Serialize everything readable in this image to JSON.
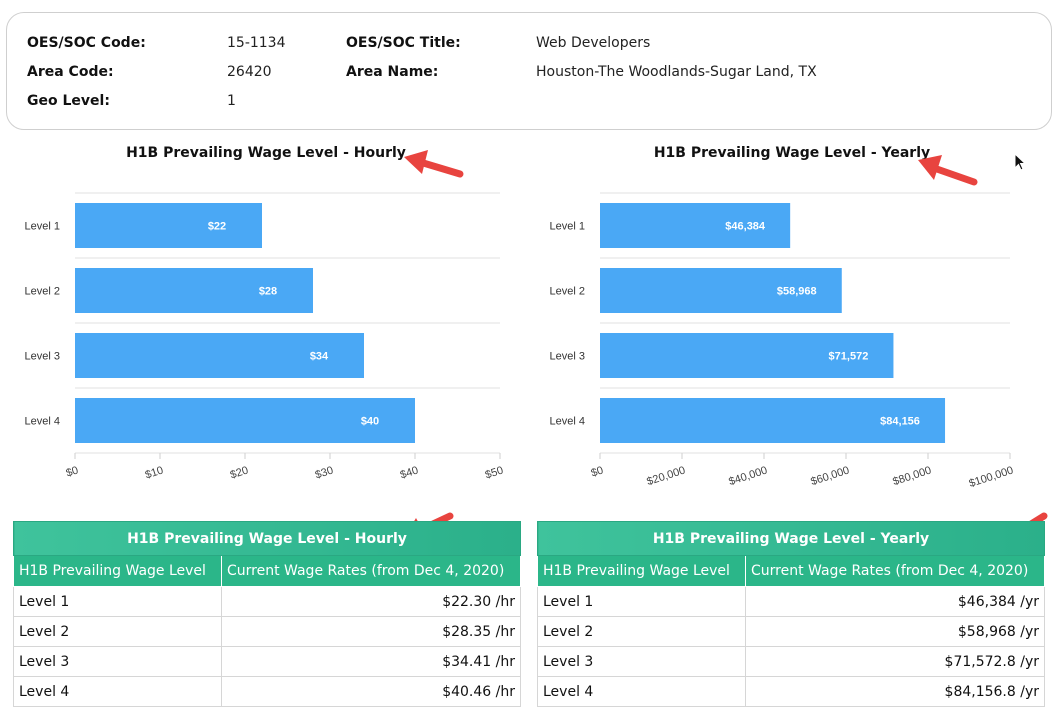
{
  "info": {
    "oes_code_label": "OES/SOC Code:",
    "oes_code_value": "15-1134",
    "oes_title_label": "OES/SOC Title:",
    "oes_title_value": "Web Developers",
    "area_code_label": "Area Code:",
    "area_code_value": "26420",
    "area_name_label": "Area Name:",
    "area_name_value": "Houston-The Woodlands-Sugar Land, TX",
    "geo_level_label": "Geo Level:",
    "geo_level_value": "1"
  },
  "colors": {
    "bar": "#4aa8f5",
    "table_header": "#2bb689",
    "arrow": "#e8443f"
  },
  "chart_data": [
    {
      "type": "bar",
      "orientation": "horizontal",
      "title": "H1B Prevailing Wage Level - Hourly",
      "categories": [
        "Level 1",
        "Level 2",
        "Level 3",
        "Level 4"
      ],
      "values": [
        22,
        28,
        34,
        40
      ],
      "data_labels": [
        "$22",
        "$28",
        "$34",
        "$40"
      ],
      "xlim": [
        0,
        50
      ],
      "x_ticks": [
        "$0",
        "$10",
        "$20",
        "$30",
        "$40",
        "$50"
      ],
      "grid": true
    },
    {
      "type": "bar",
      "orientation": "horizontal",
      "title": "H1B Prevailing Wage Level - Yearly",
      "categories": [
        "Level 1",
        "Level 2",
        "Level 3",
        "Level 4"
      ],
      "values": [
        46384,
        58968,
        71572,
        84156
      ],
      "data_labels": [
        "$46,384",
        "$58,968",
        "$71,572",
        "$84,156"
      ],
      "xlim": [
        0,
        100000
      ],
      "x_ticks": [
        "$0",
        "$20,000",
        "$40,000",
        "$60,000",
        "$80,000",
        "$100,000"
      ],
      "grid": true
    }
  ],
  "tables": {
    "hourly": {
      "caption": "H1B Prevailing Wage Level - Hourly",
      "col1": "H1B Prevailing Wage Level",
      "col2": "Current Wage Rates (from Dec 4, 2020)",
      "rows": [
        {
          "level": "Level 1",
          "rate": "$22.30 /hr"
        },
        {
          "level": "Level 2",
          "rate": "$28.35 /hr"
        },
        {
          "level": "Level 3",
          "rate": "$34.41 /hr"
        },
        {
          "level": "Level 4",
          "rate": "$40.46 /hr"
        }
      ]
    },
    "yearly": {
      "caption": "H1B Prevailing Wage Level - Yearly",
      "col1": "H1B Prevailing Wage Level",
      "col2": "Current Wage Rates (from Dec 4, 2020)",
      "rows": [
        {
          "level": "Level 1",
          "rate": "$46,384 /yr"
        },
        {
          "level": "Level 2",
          "rate": "$58,968 /yr"
        },
        {
          "level": "Level 3",
          "rate": "$71,572.8 /yr"
        },
        {
          "level": "Level 4",
          "rate": "$84,156.8 /yr"
        }
      ]
    }
  }
}
